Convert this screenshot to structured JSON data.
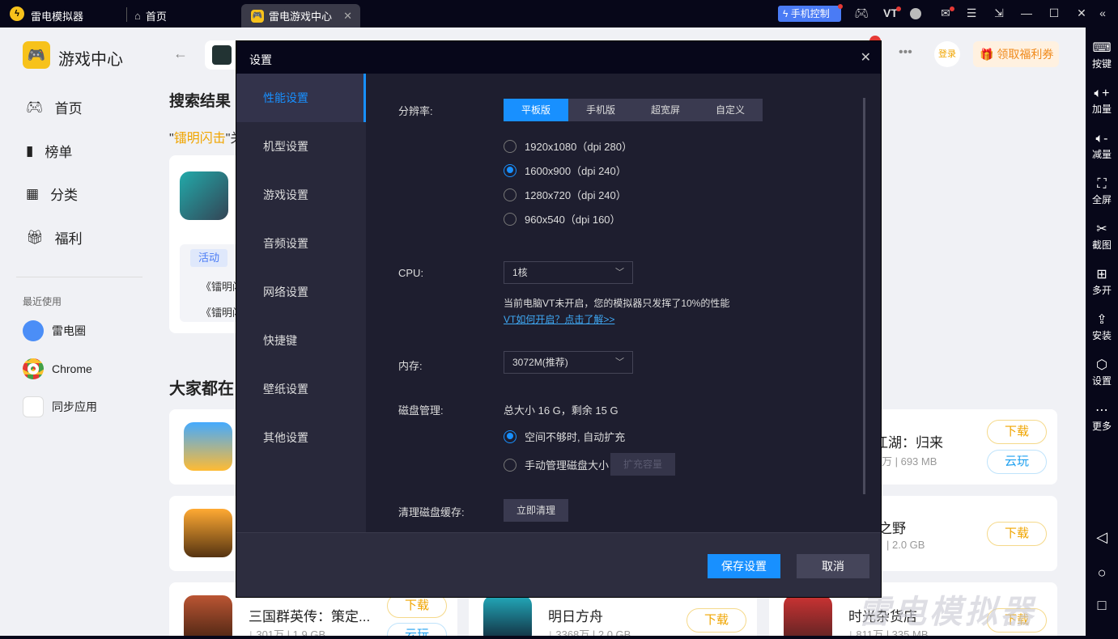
{
  "titlebar": {
    "app_name": "雷电模拟器",
    "home_tab": "首页",
    "active_tab": "雷电游戏中心",
    "phone_control": "手机控制",
    "vt_label": "VT"
  },
  "sidebar": {
    "title": "游戏中心",
    "items": [
      {
        "label": "首页",
        "icon": "gamepad-icon"
      },
      {
        "label": "榜单",
        "icon": "chart-icon"
      },
      {
        "label": "分类",
        "icon": "grid-icon"
      },
      {
        "label": "福利",
        "icon": "gift-icon"
      }
    ],
    "recent_label": "最近使用",
    "recent": [
      {
        "label": "雷电圈"
      },
      {
        "label": "Chrome"
      },
      {
        "label": "同步应用"
      }
    ]
  },
  "header": {
    "login": "登录",
    "coupon": "领取福利券"
  },
  "search": {
    "title": "搜索结果",
    "query": "镭明闪击",
    "query_suffix": "\"关",
    "tag": "活动",
    "news": [
      "《镭明闪",
      "《镭明闪"
    ]
  },
  "popular": {
    "title": "大家都在",
    "games": [
      {
        "name": "江湖：归来",
        "meta": "万 | 693 MB",
        "download": "下载",
        "cloud": "云玩"
      },
      {
        "name": "之野",
        "meta": "| 2.0 GB",
        "download": "下载"
      },
      {
        "name": "三国群英传：策定...",
        "meta": "⤓ 301万 | 1.9 GB",
        "download": "下载",
        "cloud": "云玩"
      },
      {
        "name": "明日方舟",
        "meta": "⤓ 3368万 | 2.0 GB",
        "download": "下载"
      },
      {
        "name": "时光杂货店",
        "meta": "⤓ 811万 | 335 MB",
        "download": "下载"
      }
    ]
  },
  "rightbar": [
    {
      "label": "按键"
    },
    {
      "label": "加量"
    },
    {
      "label": "减量"
    },
    {
      "label": "全屏"
    },
    {
      "label": "截图"
    },
    {
      "label": "多开"
    },
    {
      "label": "安装"
    },
    {
      "label": "设置"
    },
    {
      "label": "更多"
    }
  ],
  "settings": {
    "title": "设置",
    "menu": [
      {
        "label": "性能设置"
      },
      {
        "label": "机型设置"
      },
      {
        "label": "游戏设置"
      },
      {
        "label": "音频设置"
      },
      {
        "label": "网络设置"
      },
      {
        "label": "快捷键"
      },
      {
        "label": "壁纸设置"
      },
      {
        "label": "其他设置"
      }
    ],
    "resolution_label": "分辨率:",
    "resolution_tabs": [
      "平板版",
      "手机版",
      "超宽屏",
      "自定义"
    ],
    "resolutions": [
      "1920x1080（dpi 280）",
      "1600x900（dpi 240）",
      "1280x720（dpi 240）",
      "960x540（dpi 160）"
    ],
    "selected_resolution": "1600x900（dpi 240）",
    "cpu_label": "CPU:",
    "cpu_value": "1核",
    "vt_notice": "当前电脑VT未开启，您的模拟器只发挥了10%的性能",
    "vt_link": "VT如何开启？点击了解>>",
    "memory_label": "内存:",
    "memory_value": "3072M(推荐)",
    "disk_label": "磁盘管理:",
    "disk_info": "总大小 16 G，剩余 15 G",
    "disk_auto": "空间不够时, 自动扩充",
    "disk_manual": "手动管理磁盘大小",
    "expand": "扩充容量",
    "cache_label": "清理磁盘缓存:",
    "cache_btn": "立即清理",
    "save": "保存设置",
    "cancel": "取消"
  },
  "watermark": "雷电模拟器"
}
